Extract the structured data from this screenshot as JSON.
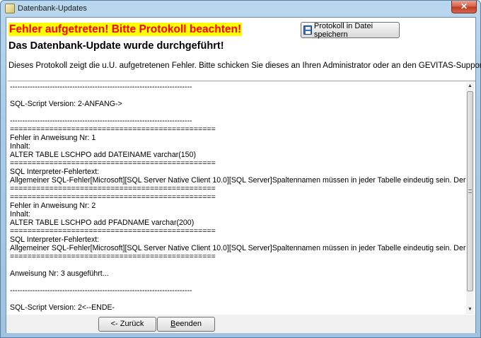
{
  "window": {
    "title": "Datenbank-Updates",
    "close_label": "✕",
    "app_icon": "database-update-icon"
  },
  "header": {
    "error_headline": "Fehler aufgetreten! Bitte Protokoll beachten!",
    "save_button_label": "Protokoll in Datei speichern",
    "save_icon": "floppy-disk-icon",
    "subtitle": "Das Datenbank-Update wurde durchgeführt!",
    "info_text": "Dieses Protokoll zeigt die u.U. aufgetretenen Fehler. Bitte schicken Sie dieses an Ihren Administrator oder an den GEVITAS-Support:"
  },
  "log": {
    "lines": [
      "-------------------------------------------------------------------------",
      "",
      "SQL-Script Version: 2-ANFANG->",
      "",
      "-------------------------------------------------------------------------",
      "===============================================",
      "Fehler in Anweisung Nr: 1",
      "Inhalt:",
      "ALTER TABLE LSCHPO add DATEINAME varchar(150)",
      "===============================================",
      "SQL Interpreter-Fehlertext:",
      "Allgemeiner SQL-Fehler[Microsoft][SQL Server Native Client 10.0][SQL Server]Spaltennamen müssen in jeder Tabelle eindeutig sein. Der Spaltenname",
      "===============================================",
      "===============================================",
      "Fehler in Anweisung Nr: 2",
      "Inhalt:",
      "ALTER TABLE LSCHPO add PFADNAME varchar(200)",
      "===============================================",
      "SQL Interpreter-Fehlertext:",
      "Allgemeiner SQL-Fehler[Microsoft][SQL Server Native Client 10.0][SQL Server]Spaltennamen müssen in jeder Tabelle eindeutig sein. Der Spaltenname",
      "===============================================",
      "",
      "Anweisung Nr: 3 ausgeführt...",
      "",
      "-------------------------------------------------------------------------",
      "",
      "SQL-Script Version: 2<--ENDE-"
    ]
  },
  "footer": {
    "back_button_label": "<- Zurück",
    "end_button_first_letter": "B",
    "end_button_rest": "eenden"
  },
  "colors": {
    "error_text": "#ff0000",
    "error_highlight": "#ffff00",
    "close_button": "#c23b22"
  }
}
